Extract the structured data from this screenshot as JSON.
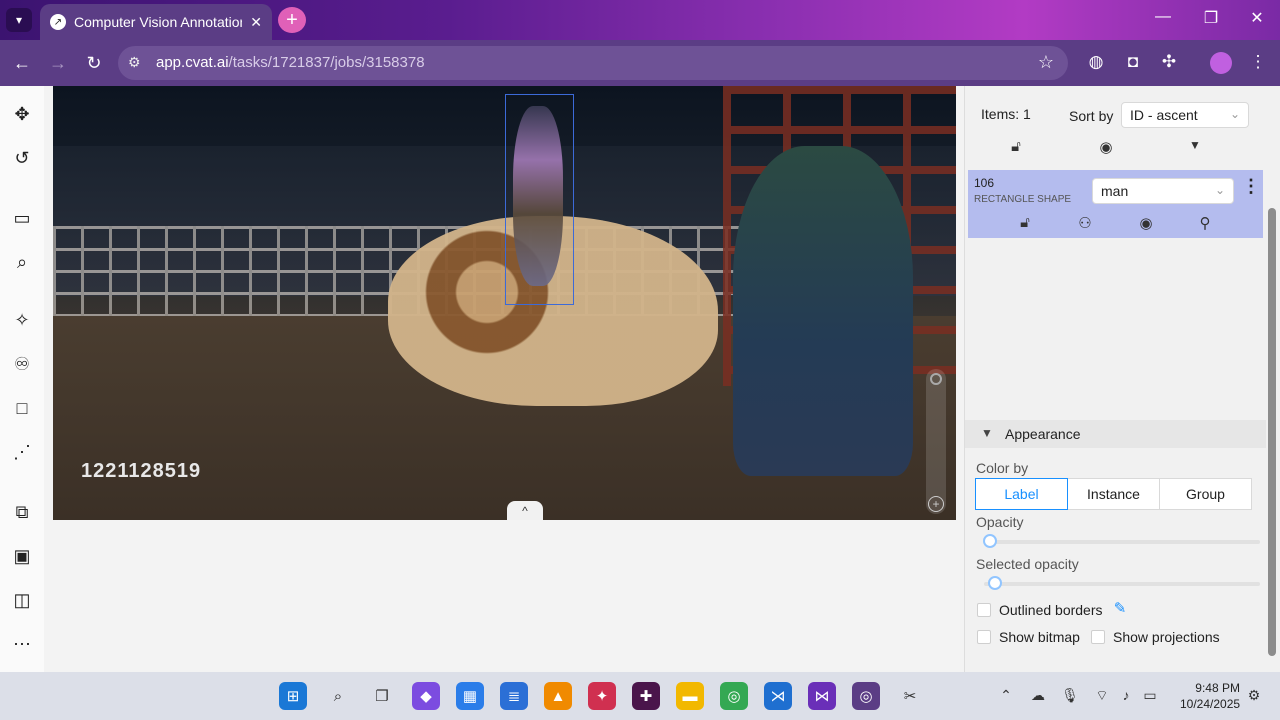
{
  "browser": {
    "tab_title": "Computer Vision Annotation Tool",
    "tab_close": "✕",
    "new_tab": "+",
    "url_host": "app.cvat.ai",
    "url_path": "/tasks/1721837/jobs/3158378",
    "win_minimize": "—",
    "win_maximize": "❐",
    "win_close": "✕",
    "icons": [
      "back-icon",
      "forward-icon",
      "reload-icon",
      "site-info-icon",
      "star-icon",
      "globe-icon",
      "extension-icon",
      "puzzle-icon",
      "profile-avatar",
      "more-icon"
    ]
  },
  "canvas": {
    "frame_number": "1221128519",
    "collapse_glyph": "^"
  },
  "objects_panel": {
    "items_count": "Items: 1",
    "sort_by_label": "Sort by",
    "sort_value": "ID - ascent",
    "object": {
      "id": "106",
      "type": "RECTANGLE SHAPE",
      "label": "man",
      "selected_color": "#b4bcee"
    }
  },
  "appearance": {
    "title": "Appearance",
    "color_by_label": "Color by",
    "color_by_options": [
      "Label",
      "Instance",
      "Group"
    ],
    "color_by_selected": "Label",
    "opacity_label": "Opacity",
    "selected_opacity_label": "Selected opacity",
    "opacity": 0.02,
    "selected_opacity": 0.04,
    "outlined_borders_label": "Outlined borders",
    "show_bitmap_label": "Show bitmap",
    "show_projections_label": "Show projections"
  },
  "taskbar": {
    "time": "9:48 PM",
    "date": "10/24/2025"
  },
  "colors": {
    "accent": "#1890ff",
    "bbox": "#3c6ad8",
    "browser_bg": "#5b3d85"
  }
}
